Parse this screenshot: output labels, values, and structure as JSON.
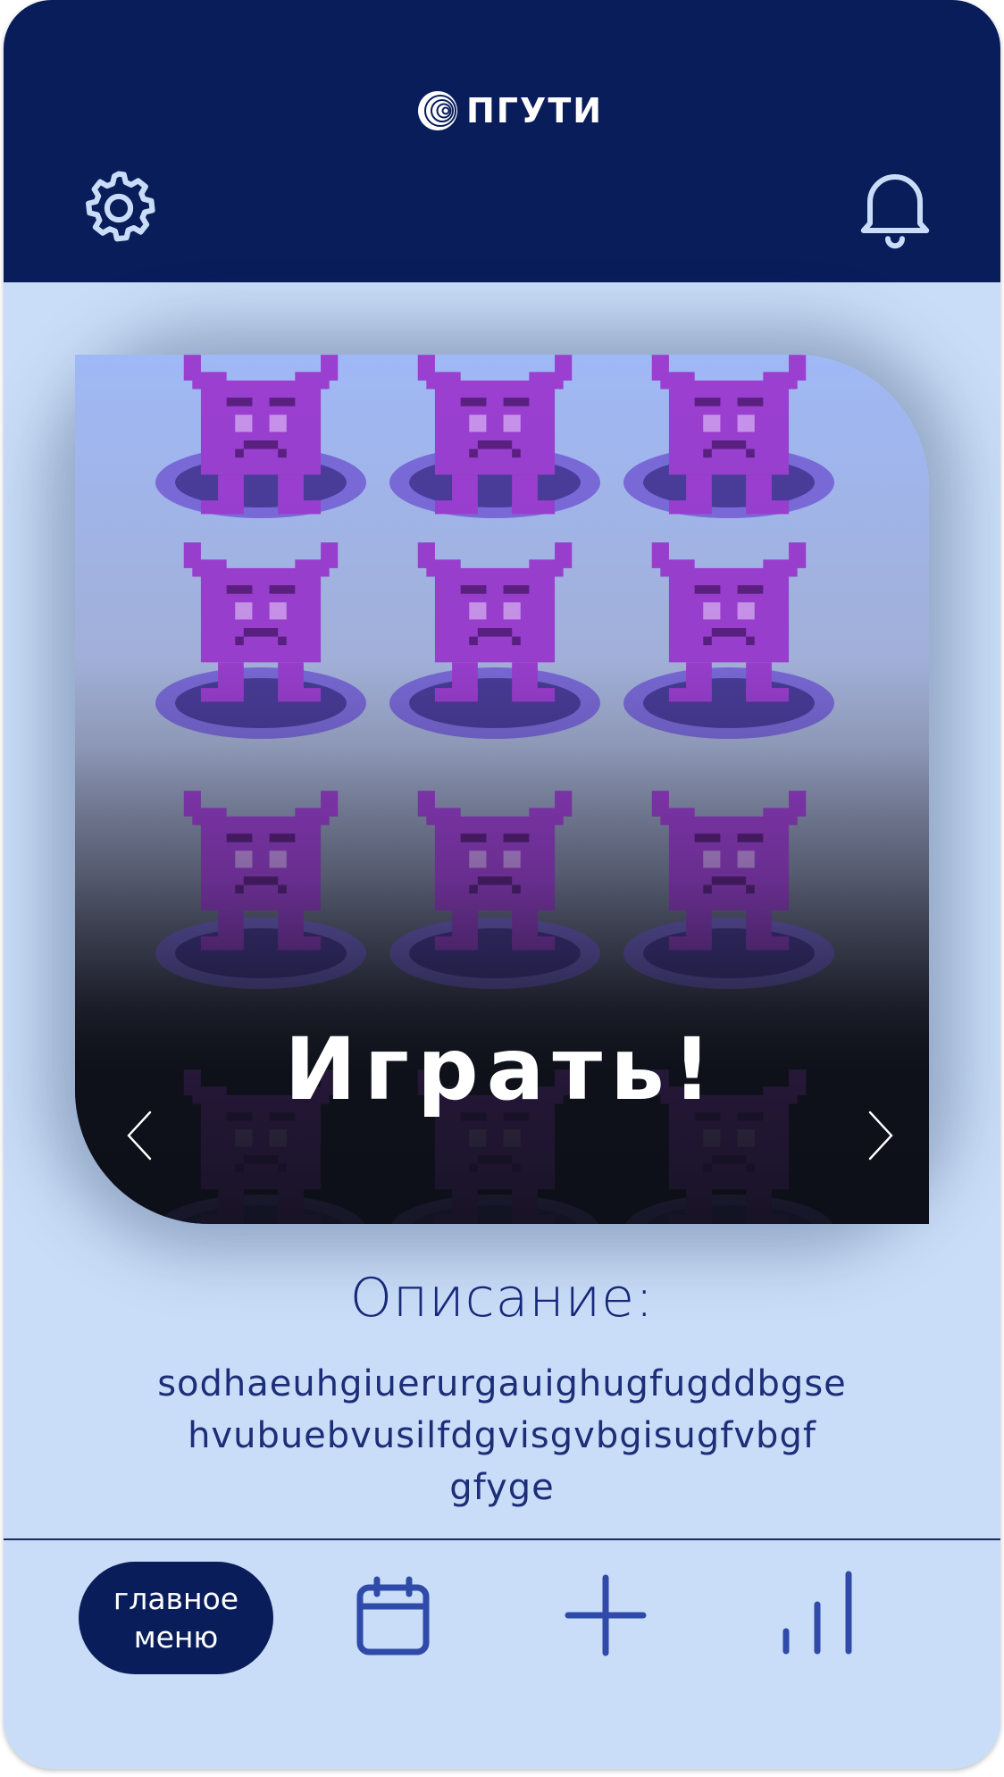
{
  "header": {
    "logo_text": "ПГУТИ",
    "settings_icon": "gear-icon",
    "notifications_icon": "bell-icon"
  },
  "game_card": {
    "play_label": "Играть!",
    "prev_icon": "chevron-left-icon",
    "next_icon": "chevron-right-icon"
  },
  "description": {
    "title": "Описание:",
    "lines": [
      "sodhaeuhgiuerurgauighugfugddbgse",
      "hvubuebvusilfdgvisgvbgisugfvbgf",
      "gfyge"
    ]
  },
  "bottom_nav": {
    "main_menu_label_line1": "главное",
    "main_menu_label_line2": "меню",
    "calendar_icon": "calendar-icon",
    "add_icon": "plus-icon",
    "stats_icon": "bar-chart-icon"
  },
  "colors": {
    "header_bg": "#0a1d5b",
    "page_bg": "#c9ddf8",
    "accent_icon": "#c9ddf8",
    "nav_icon": "#2f4aa8",
    "monster": "#9a3fd0",
    "portal": "#7a6ad8"
  }
}
